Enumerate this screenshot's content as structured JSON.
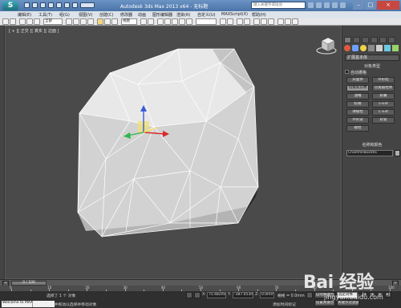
{
  "title_bar": {
    "app_title": "Autodesk 3ds Max  2013 x64   - 无标题",
    "search_placeholder": "键入关键字或短语"
  },
  "menu": {
    "items": [
      "编辑(E)",
      "工具(T)",
      "组(G)",
      "视图(V)",
      "创建(C)",
      "修改器",
      "动画",
      "图形编辑器",
      "渲染(R)",
      "自定义(U)",
      "MAXScript(X)",
      "帮助(H)"
    ]
  },
  "toolbar": {
    "selection_filter": "全部",
    "reference_coord": "视图"
  },
  "viewport": {
    "label": "[ + ][ 正交 ][ 真实 ][ 边面 ]",
    "background_color": "#4a4a4a",
    "mesh_fill": "#d8d8d8",
    "wire_color": "#ffffff"
  },
  "command_panel": {
    "category_dropdown": "扩展基本体",
    "object_type_title": "对象类型",
    "autogrid_label": "自动栅格",
    "buttons": [
      "异面体",
      "环形结",
      "切角长方体",
      "切角圆柱体",
      "油罐",
      "胶囊",
      "纺锤",
      "L-Ext",
      "球棱柱",
      "C-Ext",
      "环形波",
      "软管",
      "棱柱"
    ],
    "name_color_title": "名称和颜色",
    "object_name": "ChamferBox001"
  },
  "timeline": {
    "slider_text": "0 / 100",
    "ruler_labels": [
      "0",
      "5",
      "10",
      "15",
      "20",
      "25",
      "30",
      "35",
      "40",
      "45",
      "50",
      "55",
      "60",
      "65",
      "70",
      "75",
      "80",
      "85",
      "90",
      "95",
      "100"
    ]
  },
  "status_bar": {
    "selection_status": "选择了 1 个 对象",
    "prompt_text": "单击并拖动以选择并移动对象",
    "x_value": "75.482mm",
    "y_value": "-387.053mm",
    "z_value": "0.0mm",
    "grid_value": "栅格 = 0.0mm",
    "auto_key": "自动关键点",
    "selected_dropdown": "选定对象",
    "set_key": "设置关键点",
    "key_filters": "关键点过滤器",
    "add_time_tag": "添加时间标记",
    "listener_text": "Welcome to MAXScript."
  },
  "watermark": {
    "logo": "Bai 经验",
    "url": "jingyan.baidu.com"
  }
}
